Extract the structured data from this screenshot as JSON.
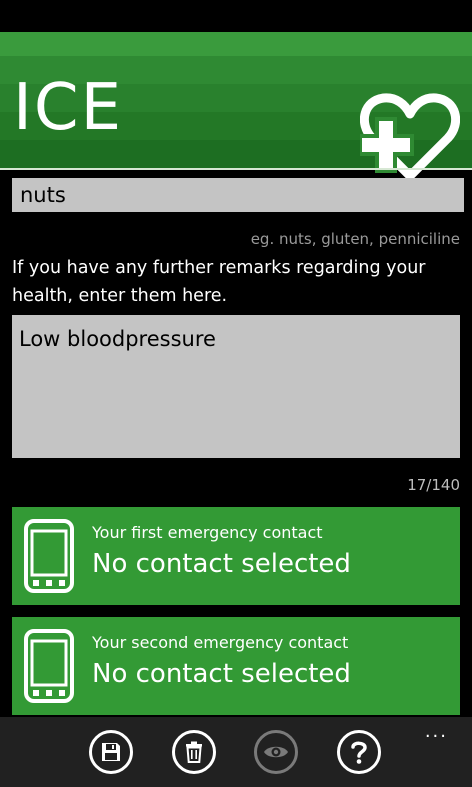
{
  "header": {
    "title": "ICE",
    "logo_icon": "heart-plus-icon"
  },
  "allergies": {
    "value": "nuts",
    "hint": "eg. nuts, gluten, penniciline"
  },
  "remarks": {
    "prompt": "If you have any further remarks regarding your health, enter them here.",
    "value": "Low bloodpressure",
    "counter": "17/140"
  },
  "contacts": [
    {
      "label": "Your first emergency contact",
      "value": "No contact selected",
      "icon": "phone-icon"
    },
    {
      "label": "Your second emergency contact",
      "value": "No contact selected",
      "icon": "phone-icon"
    }
  ],
  "appbar": {
    "buttons": [
      {
        "icon": "save-icon",
        "enabled": true
      },
      {
        "icon": "delete-icon",
        "enabled": true
      },
      {
        "icon": "preview-icon",
        "enabled": false
      },
      {
        "icon": "help-icon",
        "enabled": true
      }
    ],
    "more": "..."
  },
  "colors": {
    "accent": "#339a35",
    "header": "#2f8a33",
    "input_bg": "#c4c4c4",
    "appbar": "#212121"
  }
}
